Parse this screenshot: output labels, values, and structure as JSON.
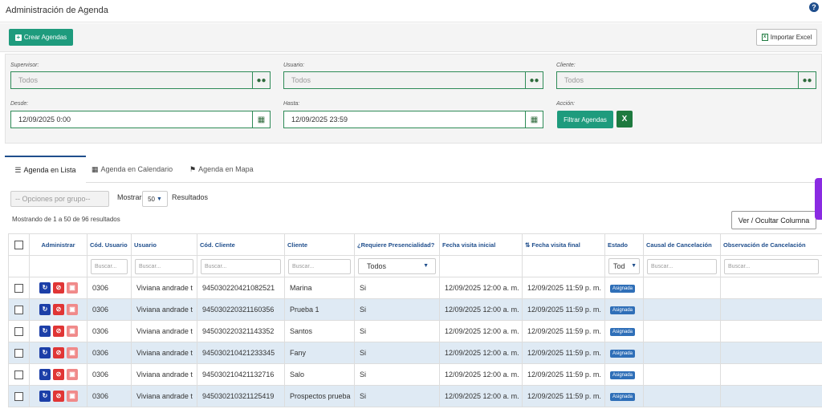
{
  "header": {
    "title": "Administración de Agenda",
    "help_icon": "question-circle-icon"
  },
  "toolbar": {
    "crear_label": "Crear Agendas",
    "importar_label": "Importar Excel"
  },
  "filters": {
    "supervisor": {
      "label": "Supervisor:",
      "placeholder": "Todos"
    },
    "usuario": {
      "label": "Usuario:",
      "placeholder": "Todos"
    },
    "cliente": {
      "label": "Cliente:",
      "placeholder": "Todos"
    },
    "desde": {
      "label": "Desde:",
      "value": "12/09/2025 0:00"
    },
    "hasta": {
      "label": "Hasta:",
      "value": "12/09/2025 23:59"
    },
    "accion": {
      "label": "Acción:",
      "filtrar_label": "Filtrar Agendas"
    }
  },
  "tabs": [
    {
      "label": "Agenda en Lista",
      "icon": "list-icon"
    },
    {
      "label": "Agenda en Calendario",
      "icon": "calendar-icon"
    },
    {
      "label": "Agenda en Mapa",
      "icon": "map-icon"
    }
  ],
  "list": {
    "group_options": "-- Opciones por grupo--",
    "show_label": "Mostrar",
    "page_size": "50",
    "results_label": "Resultados",
    "showing_text": "Mostrando de 1 a 50 de 96 resultados",
    "toggle_columns_label": "Ver / Ocultar Columna"
  },
  "table": {
    "columns": [
      "Administrar",
      "Cód. Usuario",
      "Usuario",
      "Cód. Cliente",
      "Cliente",
      "¿Requiere Presencialidad?",
      "Fecha visita inicial",
      "Fecha visita final",
      "Estado",
      "Causal de Cancelación",
      "Observación de Cancelación"
    ],
    "search_placeholder": "Buscar...",
    "presencialidad_filter": "Todos",
    "estado_filter": "Tod",
    "rows": [
      {
        "cod_usuario": "0306",
        "usuario": "Viviana andrade t",
        "cod_cliente": "945030220421082521",
        "cliente": "Marina",
        "presencialidad": "Si",
        "fecha_inicial": "12/09/2025 12:00 a. m.",
        "fecha_final": "12/09/2025 11:59 p. m.",
        "estado": "Asignada"
      },
      {
        "cod_usuario": "0306",
        "usuario": "Viviana andrade t",
        "cod_cliente": "945030220321160356",
        "cliente": "Prueba 1",
        "presencialidad": "Si",
        "fecha_inicial": "12/09/2025 12:00 a. m.",
        "fecha_final": "12/09/2025 11:59 p. m.",
        "estado": "Asignada"
      },
      {
        "cod_usuario": "0306",
        "usuario": "Viviana andrade t",
        "cod_cliente": "945030220321143352",
        "cliente": "Santos",
        "presencialidad": "Si",
        "fecha_inicial": "12/09/2025 12:00 a. m.",
        "fecha_final": "12/09/2025 11:59 p. m.",
        "estado": "Asignada"
      },
      {
        "cod_usuario": "0306",
        "usuario": "Viviana andrade t",
        "cod_cliente": "945030210421233345",
        "cliente": "Fany",
        "presencialidad": "Si",
        "fecha_inicial": "12/09/2025 12:00 a. m.",
        "fecha_final": "12/09/2025 11:59 p. m.",
        "estado": "Asignada"
      },
      {
        "cod_usuario": "0306",
        "usuario": "Viviana andrade t",
        "cod_cliente": "945030210421132716",
        "cliente": "Salo",
        "presencialidad": "Si",
        "fecha_inicial": "12/09/2025 12:00 a. m.",
        "fecha_final": "12/09/2025 11:59 p. m.",
        "estado": "Asignada"
      },
      {
        "cod_usuario": "0306",
        "usuario": "Viviana andrade t",
        "cod_cliente": "945030210321125419",
        "cliente": "Prospectos prueba",
        "presencialidad": "Si",
        "fecha_inicial": "12/09/2025 12:00 a. m.",
        "fecha_final": "12/09/2025 11:59 p. m.",
        "estado": "Asignada"
      }
    ]
  },
  "colors": {
    "primary_green": "#1e9b7d",
    "header_blue": "#1f4e8c",
    "alt_row": "#dfeaf4",
    "badge_blue": "#2f6fb8"
  }
}
